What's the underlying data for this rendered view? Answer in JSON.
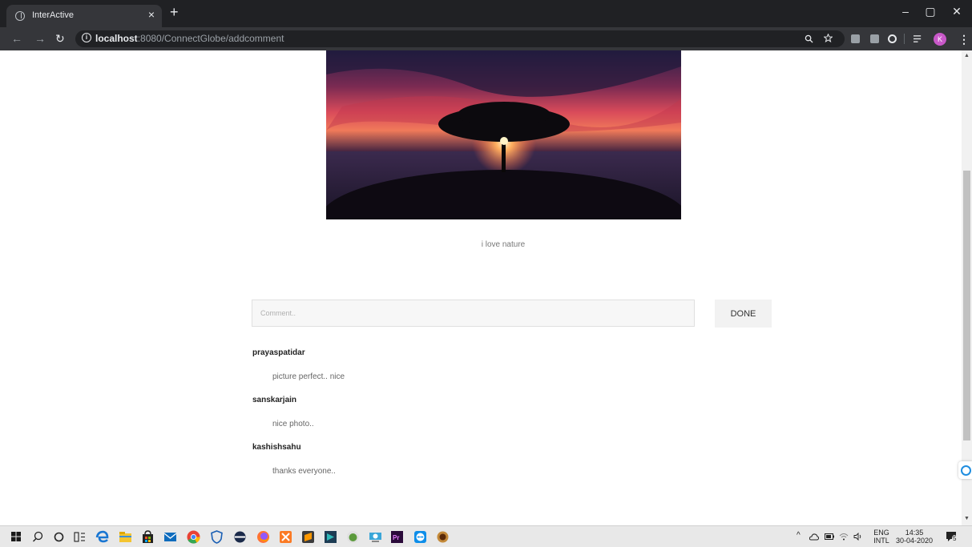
{
  "browser": {
    "tab_title": "InterActive",
    "tab_close": "×",
    "new_tab": "+",
    "url_host": "localhost",
    "url_path": ":8080/ConnectGlobe/addcomment",
    "profile_initial": "K",
    "window_buttons": {
      "minimize": "–",
      "maximize": "▢",
      "close": "✕"
    }
  },
  "post": {
    "image": "tree-at-sunset-photo",
    "caption": "i love nature"
  },
  "comment_form": {
    "placeholder": "Comment..",
    "submit_label": "DONE"
  },
  "comments": [
    {
      "user": "prayaspatidar",
      "text": "picture perfect.. nice"
    },
    {
      "user": "sanskarjain",
      "text": "nice photo.."
    },
    {
      "user": "kashishsahu",
      "text": "thanks everyone.."
    }
  ],
  "taskbar": {
    "language_top": "ENG",
    "language_bottom": "INTL",
    "time": "14:35",
    "date": "30-04-2020",
    "notification_count": "5",
    "pinned_icons": [
      "windows-start-icon",
      "search-icon",
      "cortana-icon",
      "task-view-icon",
      "edge-icon",
      "file-explorer-icon",
      "store-icon",
      "mail-icon",
      "chrome-icon",
      "app-shield-icon",
      "app-circle-icon",
      "firefox-icon",
      "xampp-icon",
      "sublime-icon",
      "app-bracket-icon",
      "app-android-icon",
      "app-camera-icon",
      "premiere-icon",
      "teamviewer-icon",
      "app-emblem-icon"
    ]
  },
  "colors": {
    "chrome_dark": "#202124",
    "chrome_toolbar": "#35363a",
    "profile": "#c858c8",
    "taskbar": "#e8e8e8"
  }
}
